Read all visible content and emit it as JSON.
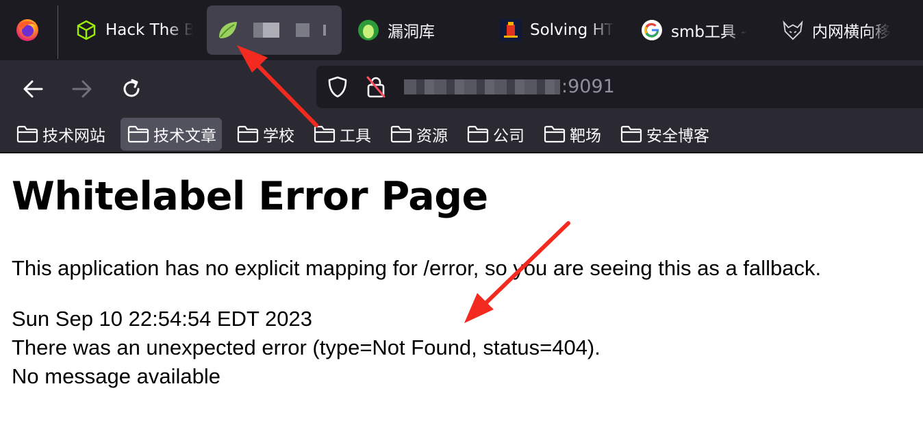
{
  "tabs": [
    {
      "title": "Hack The B",
      "icon": "hackthebox-cube-icon"
    },
    {
      "title": "",
      "icon": "spring-leaf-icon",
      "active": true
    },
    {
      "title": "漏洞库",
      "icon": "green-blob-icon"
    },
    {
      "title": "Solving HT",
      "icon": "castle-icon"
    },
    {
      "title": "smb工具 -",
      "icon": "google-g-icon"
    },
    {
      "title": "内网横向移",
      "icon": "wolf-icon"
    }
  ],
  "address_bar": {
    "url_visible_suffix": ":9091"
  },
  "bookmarks": [
    {
      "label": "技术网站"
    },
    {
      "label": "技术文章"
    },
    {
      "label": "学校"
    },
    {
      "label": "工具"
    },
    {
      "label": "资源"
    },
    {
      "label": "公司"
    },
    {
      "label": "靶场"
    },
    {
      "label": "安全博客"
    }
  ],
  "page": {
    "heading": "Whitelabel Error Page",
    "explanation": "This application has no explicit mapping for /error, so you are seeing this as a fallback.",
    "timestamp": "Sun Sep 10 22:54:54 EDT 2023",
    "error_line": "There was an unexpected error (type=Not Found, status=404).",
    "message_line": "No message available"
  },
  "colors": {
    "tabstrip_bg": "#1c1b22",
    "toolbar_bg": "#2b2a33",
    "active_tab_bg": "#42414d",
    "annotation_red": "#f22a1f"
  }
}
